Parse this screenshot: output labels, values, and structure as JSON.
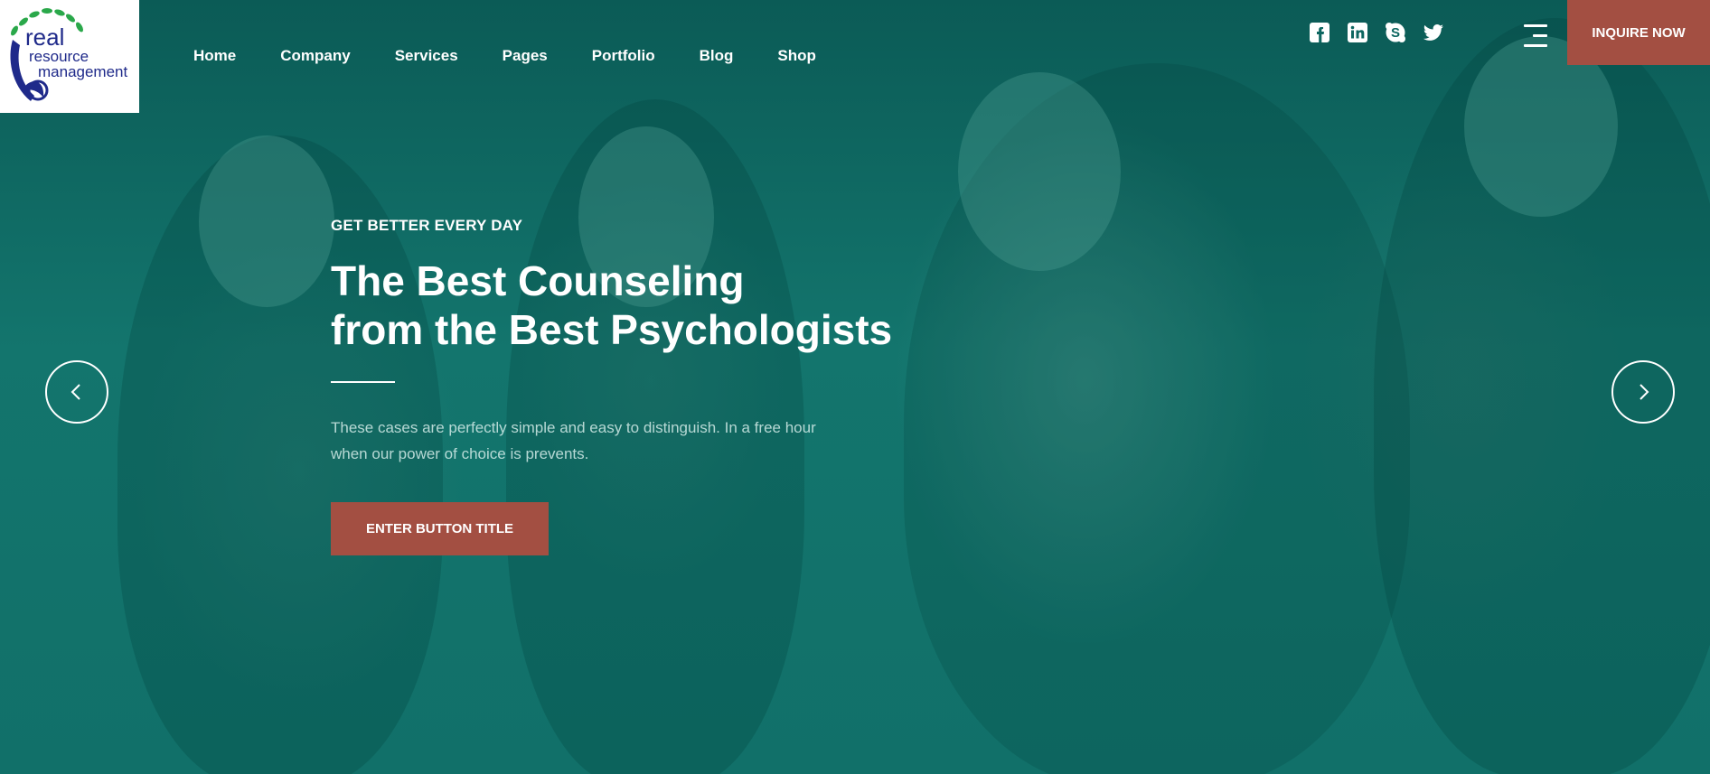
{
  "brand": {
    "logo_text_line1": "real",
    "logo_text_line2": "resource",
    "logo_text_line3": "management"
  },
  "nav": {
    "items": [
      {
        "label": "Home"
      },
      {
        "label": "Company"
      },
      {
        "label": "Services"
      },
      {
        "label": "Pages"
      },
      {
        "label": "Portfolio"
      },
      {
        "label": "Blog"
      },
      {
        "label": "Shop"
      }
    ]
  },
  "social": [
    "facebook-icon",
    "linkedin-icon",
    "skype-icon",
    "twitter-icon"
  ],
  "header": {
    "cta_label": "INQUIRE NOW"
  },
  "hero": {
    "eyebrow": "GET BETTER EVERY DAY",
    "title_line1": "The Best Counseling",
    "title_line2": "from the Best Psychologists",
    "description": "These cases are perfectly simple and easy to distinguish. In a free hour when our power of choice is prevents.",
    "button_label": "ENTER BUTTON TITLE"
  },
  "colors": {
    "accent": "#a34f42",
    "overlay": "#0f6a63",
    "text": "#ffffff"
  }
}
